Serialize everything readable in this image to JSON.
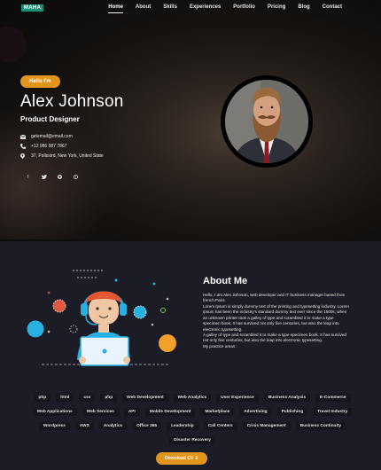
{
  "logo": "MAHA",
  "nav": [
    "Home",
    "About",
    "Skills",
    "Experiences",
    "Portfolio",
    "Pricing",
    "Blog",
    "Contact"
  ],
  "hero": {
    "badge": "Hello I'm",
    "name": "Alex Johnson",
    "role": "Product Designer",
    "email": "getemail@email.com",
    "phone": "+12 986 987 7867",
    "address": "37, Pollsstrd, New York, United State",
    "socials": [
      "facebook-icon",
      "twitter-icon",
      "github-icon",
      "dribbble-icon"
    ]
  },
  "about": {
    "title": "About Me",
    "paragraphs": [
      "Hello, I am Alex Johnson, web developer and IT business manager based from french Paris.",
      "Lorem Ipsum is simply dummy text of the printing and typesetting industry. Lorem Ipsum has been the industry's standard dummy text ever since the 1500s, when an unknown printer took a galley of type and scrambled it to make a type specimen book. It has survived not only five centuries, but also the leap into electronic typesetting.",
      "A galley of type and scrambled it to make a type specimen book. It has survived not only five centuries, but also the leap into electronic typesetting.",
      "My practice areas :"
    ]
  },
  "skills": [
    "php",
    "html",
    "css",
    "php",
    "Web Development",
    "Web Analytics",
    "User Experience",
    "Business Analysis",
    "E-Commerce",
    "Web Applications",
    "Web Services",
    "API",
    "Mobile Development",
    "Marketplace",
    "Advertising",
    "Publishing",
    "Travel Industry",
    "Wordpress",
    "AWS",
    "Analytics",
    "Office 365",
    "Leadership",
    "Call Centers",
    "Crisis Management",
    "Business Continuity",
    "Disaster Recovery"
  ],
  "cv_button": "Download CV",
  "colors": {
    "accent": "#e2951b",
    "logo_bg": "#1d8f72",
    "about_bg": "#1c1c26"
  }
}
